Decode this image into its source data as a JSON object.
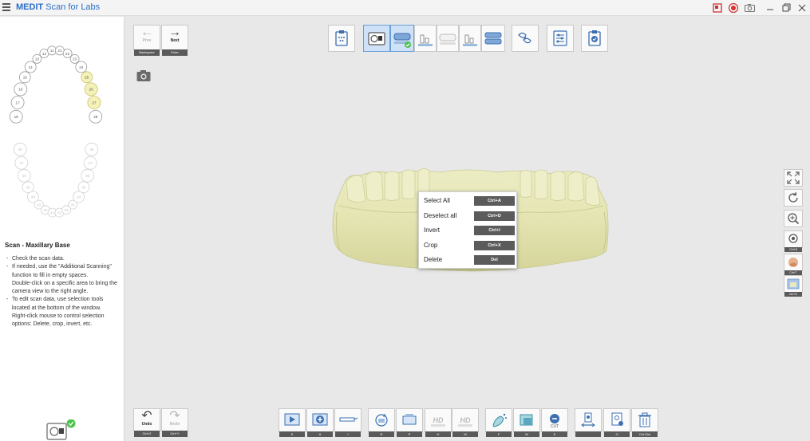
{
  "app": {
    "brand": "MEDIT",
    "title": "Scan for Labs"
  },
  "sidebar": {
    "step_title": "Scan - Maxillary Base",
    "instructions": [
      "Check the scan data.",
      "If needed, use the \"Additional Scanning\" function to fill in empty spaces.\nDouble-click on a specific area to bring the camera view to the right angle.",
      "To edit scan data, use selection tools located at the bottom of the window.\nRight-click mouse to control selection options: Delete, crop, invert, etc."
    ],
    "scan_progress": 1.0,
    "teeth_upper": [
      "18",
      "17",
      "16",
      "15",
      "14",
      "13",
      "12",
      "11",
      "21",
      "22",
      "23",
      "24",
      "25",
      "26",
      "27",
      "28"
    ],
    "teeth_lower": [
      "48",
      "47",
      "46",
      "45",
      "44",
      "43",
      "42",
      "41",
      "31",
      "32",
      "33",
      "34",
      "35",
      "36",
      "37",
      "38"
    ],
    "teeth_highlighted": [
      "25",
      "26",
      "27"
    ]
  },
  "navigation": {
    "prev_label": "Prev",
    "prev_key": "Backspace",
    "next_label": "Next",
    "next_key": "Enter",
    "undo_label": "Undo",
    "undo_key": "Ctrl+Z",
    "redo_label": "Redo",
    "redo_key": "Ctrl+Y"
  },
  "context_menu": [
    {
      "label": "Select All",
      "shortcut": "Ctrl+A"
    },
    {
      "label": "Deselect all",
      "shortcut": "Ctrl+D"
    },
    {
      "label": "Invert",
      "shortcut": "Ctrl+I"
    },
    {
      "label": "Crop",
      "shortcut": "Ctrl+X"
    },
    {
      "label": "Delete",
      "shortcut": "Del"
    }
  ],
  "right_tools": [
    {
      "name": "fit-to-screen-icon",
      "key": ""
    },
    {
      "name": "rotate-icon",
      "key": ""
    },
    {
      "name": "zoom-icon",
      "key": ""
    },
    {
      "name": "texture-icon",
      "key": "Ctrl+B"
    },
    {
      "name": "color-icon",
      "key": "Ctrl+T"
    },
    {
      "name": "image-icon",
      "key": "Ctrl+G"
    }
  ],
  "bottom_toolbar": [
    {
      "name": "play-icon",
      "key": "S"
    },
    {
      "name": "additional-scan-icon",
      "key": "A"
    },
    {
      "name": "scanner-tip-icon",
      "key": "I"
    },
    {
      "name": "rotate-view-icon",
      "key": "R"
    },
    {
      "name": "scan-bed-icon",
      "key": "P"
    },
    {
      "name": "hd-icon",
      "key": "H"
    },
    {
      "name": "hd-multi-icon",
      "key": "M"
    },
    {
      "name": "brush-select-icon",
      "key": "F"
    },
    {
      "name": "box-select-icon",
      "key": "W"
    },
    {
      "name": "erase-icon",
      "key": "E"
    },
    {
      "name": "align-icon",
      "key": ""
    },
    {
      "name": "copy-icon",
      "key": "O"
    },
    {
      "name": "trash-icon",
      "key": "Ctrl+Del"
    }
  ],
  "colors": {
    "accent": "#2a6fc7",
    "model": "#e4e4b2",
    "progress": "#4cc24c",
    "recording": "#d93030"
  }
}
